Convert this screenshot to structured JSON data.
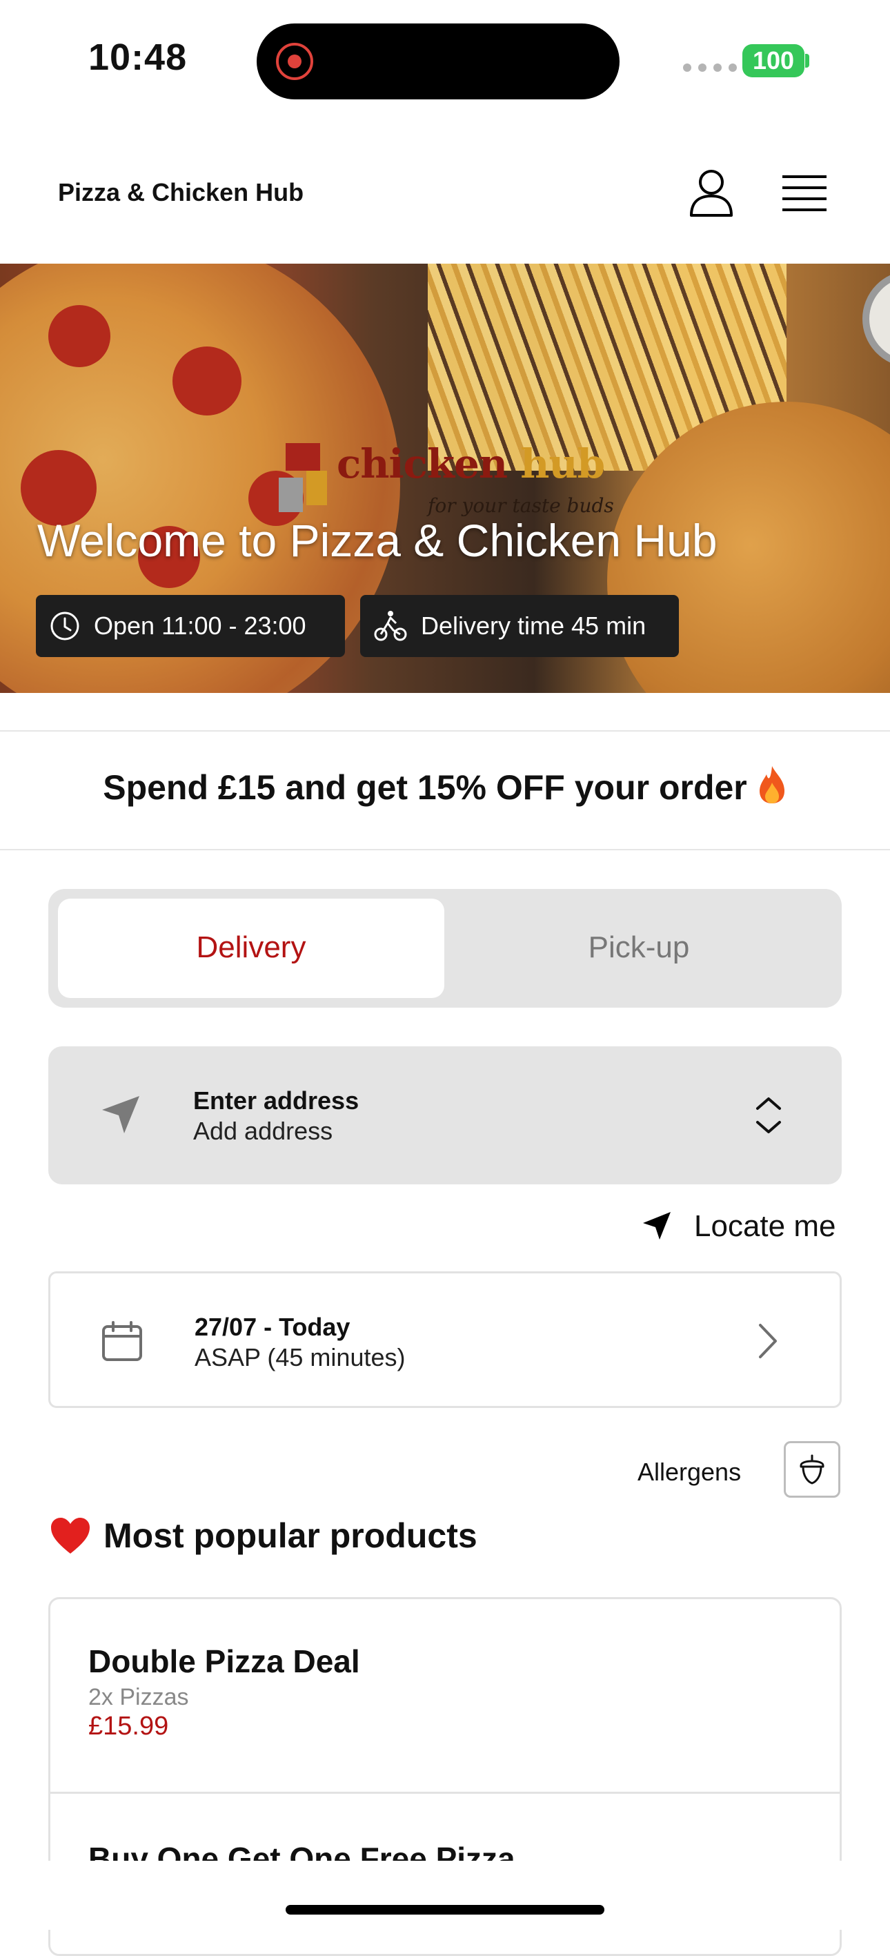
{
  "status_bar": {
    "time": "10:48",
    "battery": "100"
  },
  "header": {
    "title": "Pizza & Chicken Hub"
  },
  "hero": {
    "logo_word1": "chicken",
    "logo_word2": "hub",
    "logo_tagline": "for your taste buds",
    "title": "Welcome to Pizza & Chicken Hub",
    "open_hours": "Open 11:00 - 23:00",
    "delivery_time": "Delivery time 45 min"
  },
  "promo": {
    "text": "Spend £15 and get 15% OFF your order"
  },
  "order_mode": {
    "delivery_label": "Delivery",
    "pickup_label": "Pick-up",
    "selected": "Delivery"
  },
  "address": {
    "title": "Enter address",
    "subtitle": "Add address"
  },
  "locate": {
    "label": "Locate me"
  },
  "schedule": {
    "date": "27/07 - Today",
    "time": "ASAP (45 minutes)"
  },
  "allergens": {
    "label": "Allergens"
  },
  "popular": {
    "title": "Most popular products",
    "products": [
      {
        "name": "Double Pizza Deal",
        "description": "2x Pizzas",
        "price": "£15.99"
      },
      {
        "name": "Buy One Get One Free Pizza"
      }
    ]
  },
  "colors": {
    "accent": "#b31313",
    "battery": "#35c759",
    "pill_bg": "#1e1e1e",
    "segment_bg": "#e4e4e4"
  }
}
